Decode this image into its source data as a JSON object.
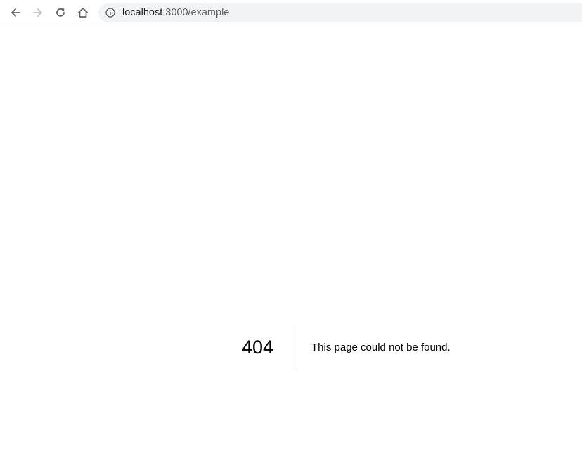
{
  "browser": {
    "back_icon": "arrow-left-icon",
    "forward_icon": "arrow-right-icon",
    "reload_icon": "reload-icon",
    "home_icon": "home-icon",
    "site_info_icon": "info-icon",
    "url_host": "localhost",
    "url_rest": ":3000/example"
  },
  "page": {
    "error_code": "404",
    "error_message": "This page could not be found."
  },
  "colors": {
    "toolbar_bg": "#ffffff",
    "omnibox_bg": "#f1f3f4",
    "icon_color": "#5f6368",
    "disabled_icon_color": "#bdc1c6",
    "text_color": "#000000"
  }
}
